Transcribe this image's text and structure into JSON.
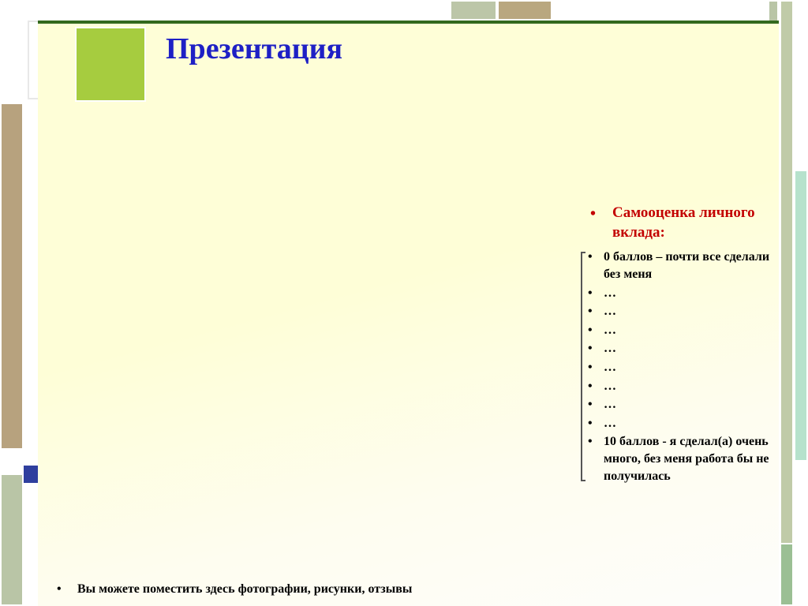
{
  "title": "Презентация",
  "section_heading": "Самооценка личного вклада:",
  "scale": [
    "0 баллов – почти все сделали без меня",
    "…",
    "…",
    "…",
    "…",
    "…",
    "…",
    "…",
    "…",
    "10 баллов - я сделал(а) очень много, без меня работа бы не получилась"
  ],
  "footer": "Вы можете поместить здесь фотографии, рисунки, отзывы"
}
